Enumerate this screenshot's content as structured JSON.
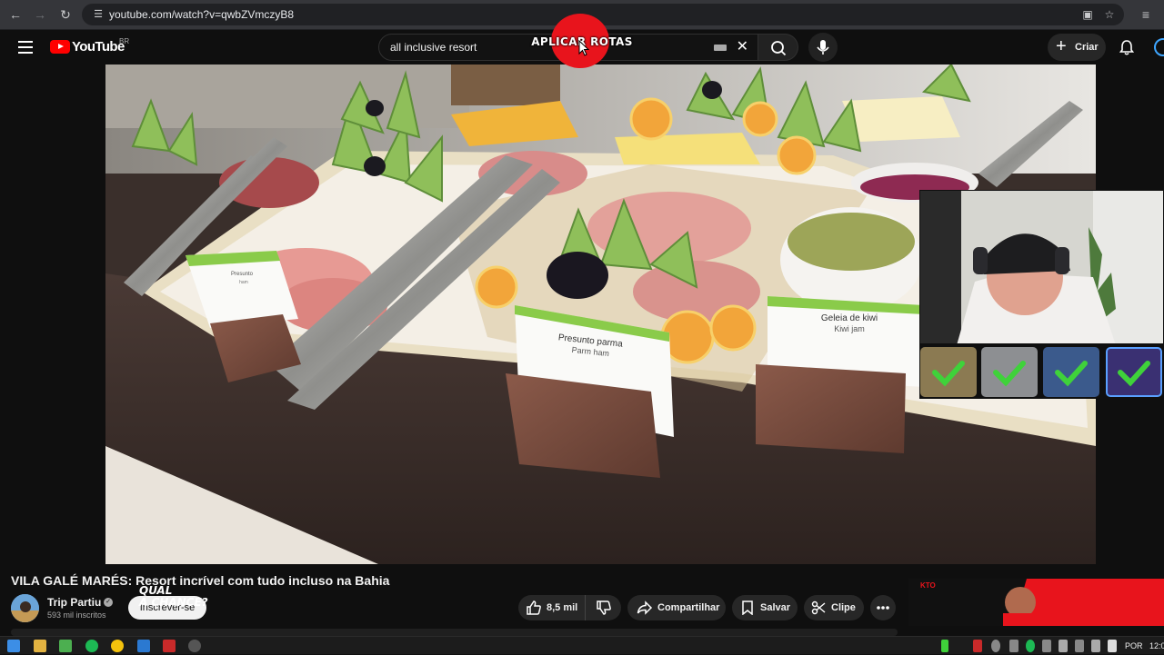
{
  "browser": {
    "url": "youtube.com/watch?v=qwbZVmczyB8",
    "icons": [
      "back-arrow-icon",
      "forward-arrow-icon",
      "reload-icon",
      "site-info-icon",
      "install-app-icon",
      "bookmark-star-icon",
      "reading-list-icon"
    ]
  },
  "header": {
    "logo_text": "YouTube",
    "country_code": "BR",
    "search_query": "all inclusive  resort",
    "create_label": "Criar",
    "icons": [
      "menu-icon",
      "search-icon",
      "mic-icon",
      "bell-icon",
      "avatar-icon"
    ]
  },
  "overlay": {
    "text": "APLICAR ROTAS",
    "color": "#e8141c"
  },
  "video": {
    "labels": {
      "card_left_title": "Presunto",
      "card_left_sub": "ham",
      "card_center_title": "Presunto parma",
      "card_center_sub": "Parm ham",
      "card_right_title": "Geleia de kiwi",
      "card_right_sub": "Kiwi jam"
    }
  },
  "watch": {
    "title": "VILA GALÉ MARÉS: Resort incrível com tudo incluso na Bahia",
    "channel_name": "Trip Partiu",
    "channel_subs": "593 mil inscritos",
    "subscribe_label": "Inscrever-se",
    "likes": "8,5 mil",
    "share_label": "Compartilhar",
    "save_label": "Salvar",
    "clip_label": "Clipe"
  },
  "ad": {
    "brand": "KTO",
    "headline": "QUAL\nA CHANCE?"
  },
  "taskbar": {
    "language": "POR",
    "time": "12:0"
  },
  "colors": {
    "yt_red": "#ff0000",
    "background": "#0f0f0f",
    "pill": "#272727",
    "emote_check": "#3fd23a"
  }
}
